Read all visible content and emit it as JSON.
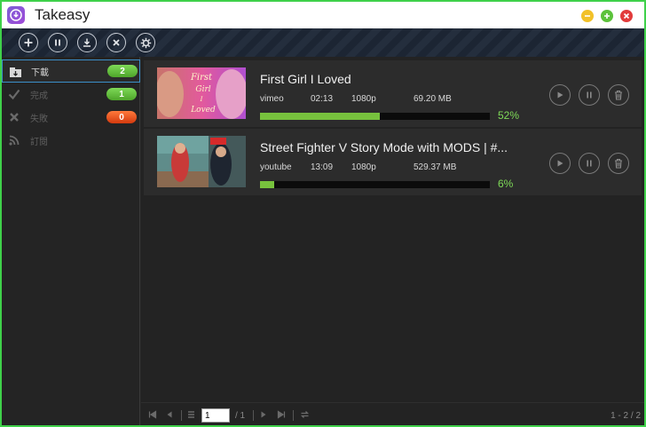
{
  "window": {
    "title": "Takeasy"
  },
  "toolbar": {
    "buttons": [
      {
        "name": "add",
        "icon": "plus-icon"
      },
      {
        "name": "pause-all",
        "icon": "pause-icon"
      },
      {
        "name": "download",
        "icon": "download-icon"
      },
      {
        "name": "remove",
        "icon": "close-icon"
      },
      {
        "name": "settings",
        "icon": "gear-icon"
      }
    ]
  },
  "sidebar": {
    "items": [
      {
        "label": "下載",
        "count": "2",
        "icon": "download-folder-icon",
        "badge_color": "#5cb833"
      },
      {
        "label": "完成",
        "count": "1",
        "icon": "check-icon",
        "badge_color": "#5cb833"
      },
      {
        "label": "失敗",
        "count": "0",
        "icon": "x-icon",
        "badge_color": "#e0501a"
      },
      {
        "label": "訂閱",
        "icon": "rss-icon"
      }
    ]
  },
  "downloads": [
    {
      "title": "First Girl I Loved",
      "source": "vimeo",
      "duration": "02:13",
      "quality": "1080p",
      "size": "69.20 MB",
      "progress": 0.52,
      "progress_label": "52%",
      "thumb_text": "First Girl I Loved"
    },
    {
      "title": "Street Fighter V Story Mode with MODS | #...",
      "source": "youtube",
      "duration": "13:09",
      "quality": "1080p",
      "size": "529.37 MB",
      "progress": 0.06,
      "progress_label": "6%",
      "thumb_text": ""
    }
  ],
  "pagination": {
    "page_value": "1",
    "page_total": "/ 1",
    "range": "1 - 2 / 2"
  },
  "colors": {
    "accent_green": "#77c23d",
    "window_border": "#3fd14a",
    "title_bar": "#ffffff"
  }
}
